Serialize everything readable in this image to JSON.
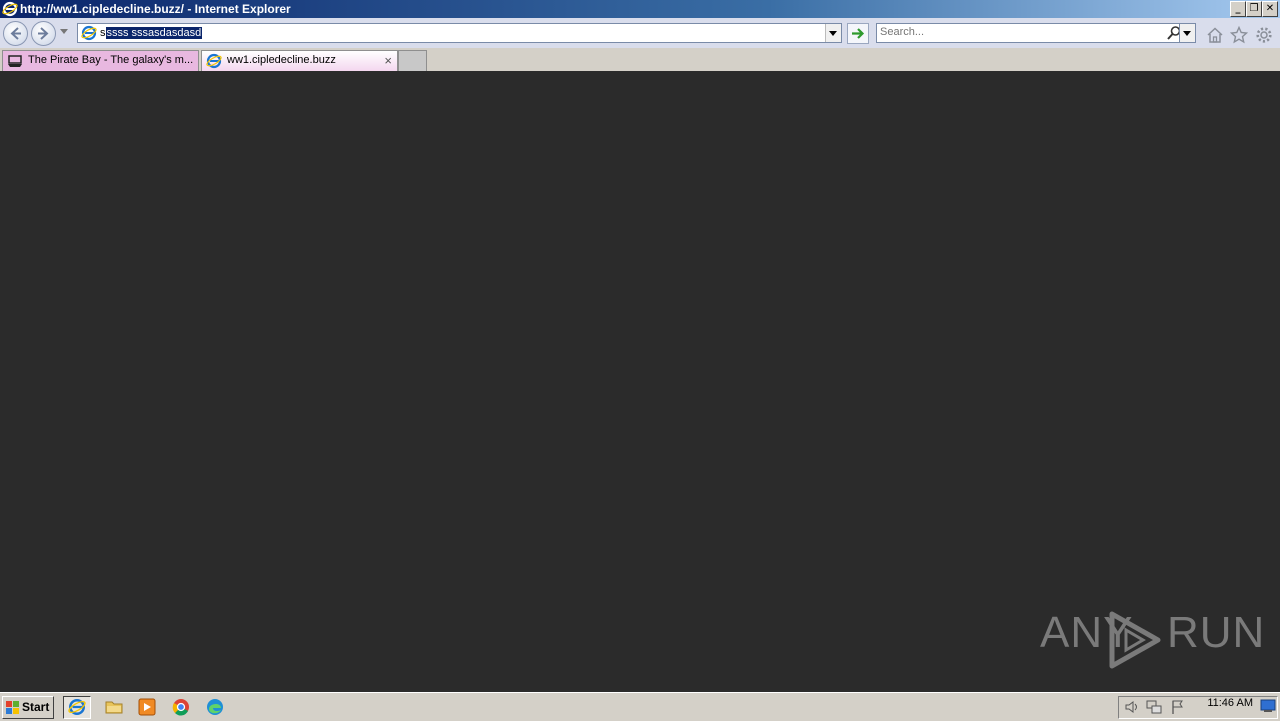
{
  "window": {
    "title": "http://ww1.cipledecline.buzz/ - Internet Explorer",
    "minimize": "_",
    "restore": "❐",
    "close": "✕"
  },
  "address_bar": {
    "value_unselected": "s",
    "value_selected": "ssss sssasdasdasd"
  },
  "search": {
    "placeholder": "Search..."
  },
  "tabs": [
    {
      "label": "The Pirate Bay - The galaxy's m..."
    },
    {
      "label": "ww1.cipledecline.buzz",
      "close": "×"
    }
  ],
  "watermark": {
    "left": "ANY",
    "right": "RUN"
  },
  "taskbar": {
    "start_label": "Start",
    "clock": "11:46 AM"
  }
}
